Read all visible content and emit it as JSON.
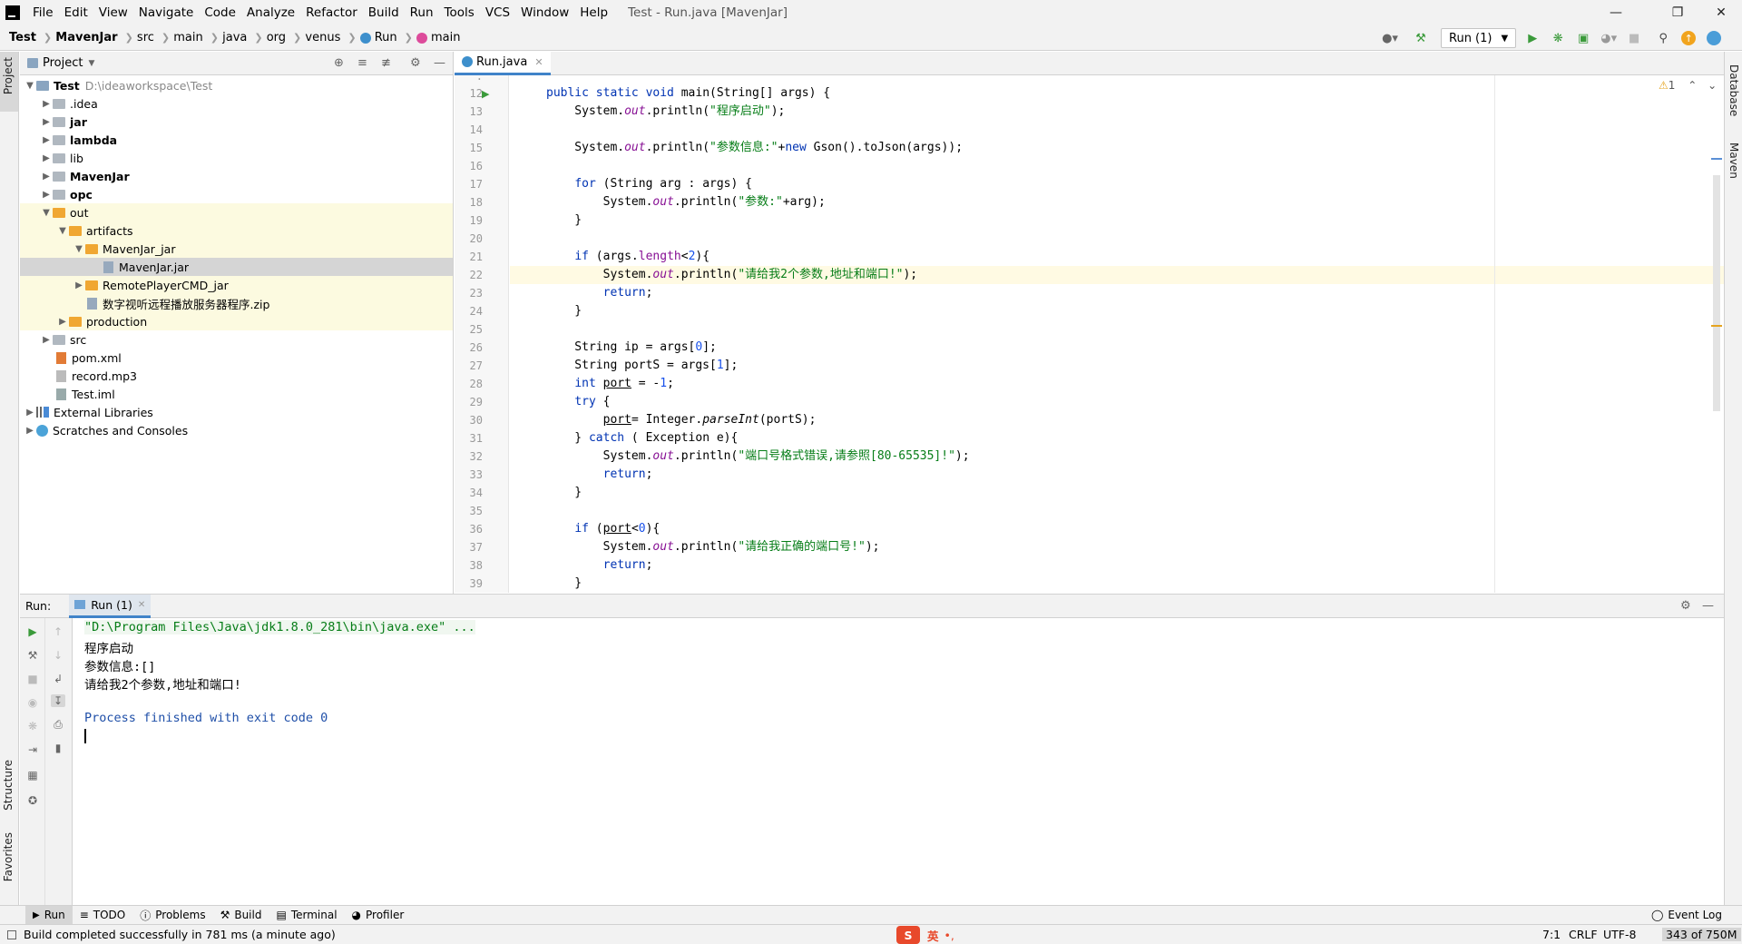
{
  "menubar": {
    "items": [
      "File",
      "Edit",
      "View",
      "Navigate",
      "Code",
      "Analyze",
      "Refactor",
      "Build",
      "Run",
      "Tools",
      "VCS",
      "Window",
      "Help"
    ],
    "title": "Test - Run.java [MavenJar]"
  },
  "breadcrumb": [
    "Test",
    "MavenJar",
    "src",
    "main",
    "java",
    "org",
    "venus",
    "Run",
    "main"
  ],
  "toolbar": {
    "run_config": "Run (1)"
  },
  "left_strip": {
    "project": "Project",
    "structure": "Structure",
    "favorites": "Favorites"
  },
  "right_strip": {
    "database": "Database",
    "maven": "Maven"
  },
  "project_panel": {
    "header": "Project",
    "tree": [
      {
        "label": "Test",
        "extra": "D:\\ideaworkspace\\Test",
        "bold": true
      },
      {
        "label": ".idea"
      },
      {
        "label": "jar",
        "bold": true
      },
      {
        "label": "lambda",
        "bold": true
      },
      {
        "label": "lib"
      },
      {
        "label": "MavenJar",
        "bold": true
      },
      {
        "label": "opc",
        "bold": true
      },
      {
        "label": "out"
      },
      {
        "label": "artifacts"
      },
      {
        "label": "MavenJar_jar"
      },
      {
        "label": "MavenJar.jar"
      },
      {
        "label": "RemotePlayerCMD_jar"
      },
      {
        "label": "数字视听远程播放服务器程序.zip"
      },
      {
        "label": "production"
      },
      {
        "label": "src"
      },
      {
        "label": "pom.xml"
      },
      {
        "label": "record.mp3"
      },
      {
        "label": "Test.iml"
      },
      {
        "label": "External Libraries"
      },
      {
        "label": "Scratches and Consoles"
      }
    ]
  },
  "editor": {
    "tab": "Run.java",
    "warnings": "1",
    "line_numbers": [
      "12",
      "13",
      "14",
      "15",
      "16",
      "17",
      "18",
      "19",
      "20",
      "21",
      "22",
      "23",
      "24",
      "25",
      "26",
      "27",
      "28",
      "29",
      "30",
      "31",
      "32",
      "33",
      "34",
      "35",
      "36",
      "37",
      "38",
      "39"
    ]
  },
  "run_panel": {
    "label": "Run:",
    "tab": "Run (1)",
    "output": [
      "\"D:\\Program Files\\Java\\jdk1.8.0_281\\bin\\java.exe\" ...",
      "程序启动",
      "参数信息:[]",
      "请给我2个参数,地址和端口!",
      "",
      "Process finished with exit code 0"
    ]
  },
  "bottom_tabs": [
    "Run",
    "TODO",
    "Problems",
    "Build",
    "Terminal",
    "Profiler"
  ],
  "event_log": "Event Log",
  "status": {
    "message": "Build completed successfully in 781 ms (a minute ago)",
    "position": "7:1",
    "line_sep": "CRLF",
    "encoding": "UTF-8",
    "memory": "343 of 750M",
    "ime": "英"
  }
}
